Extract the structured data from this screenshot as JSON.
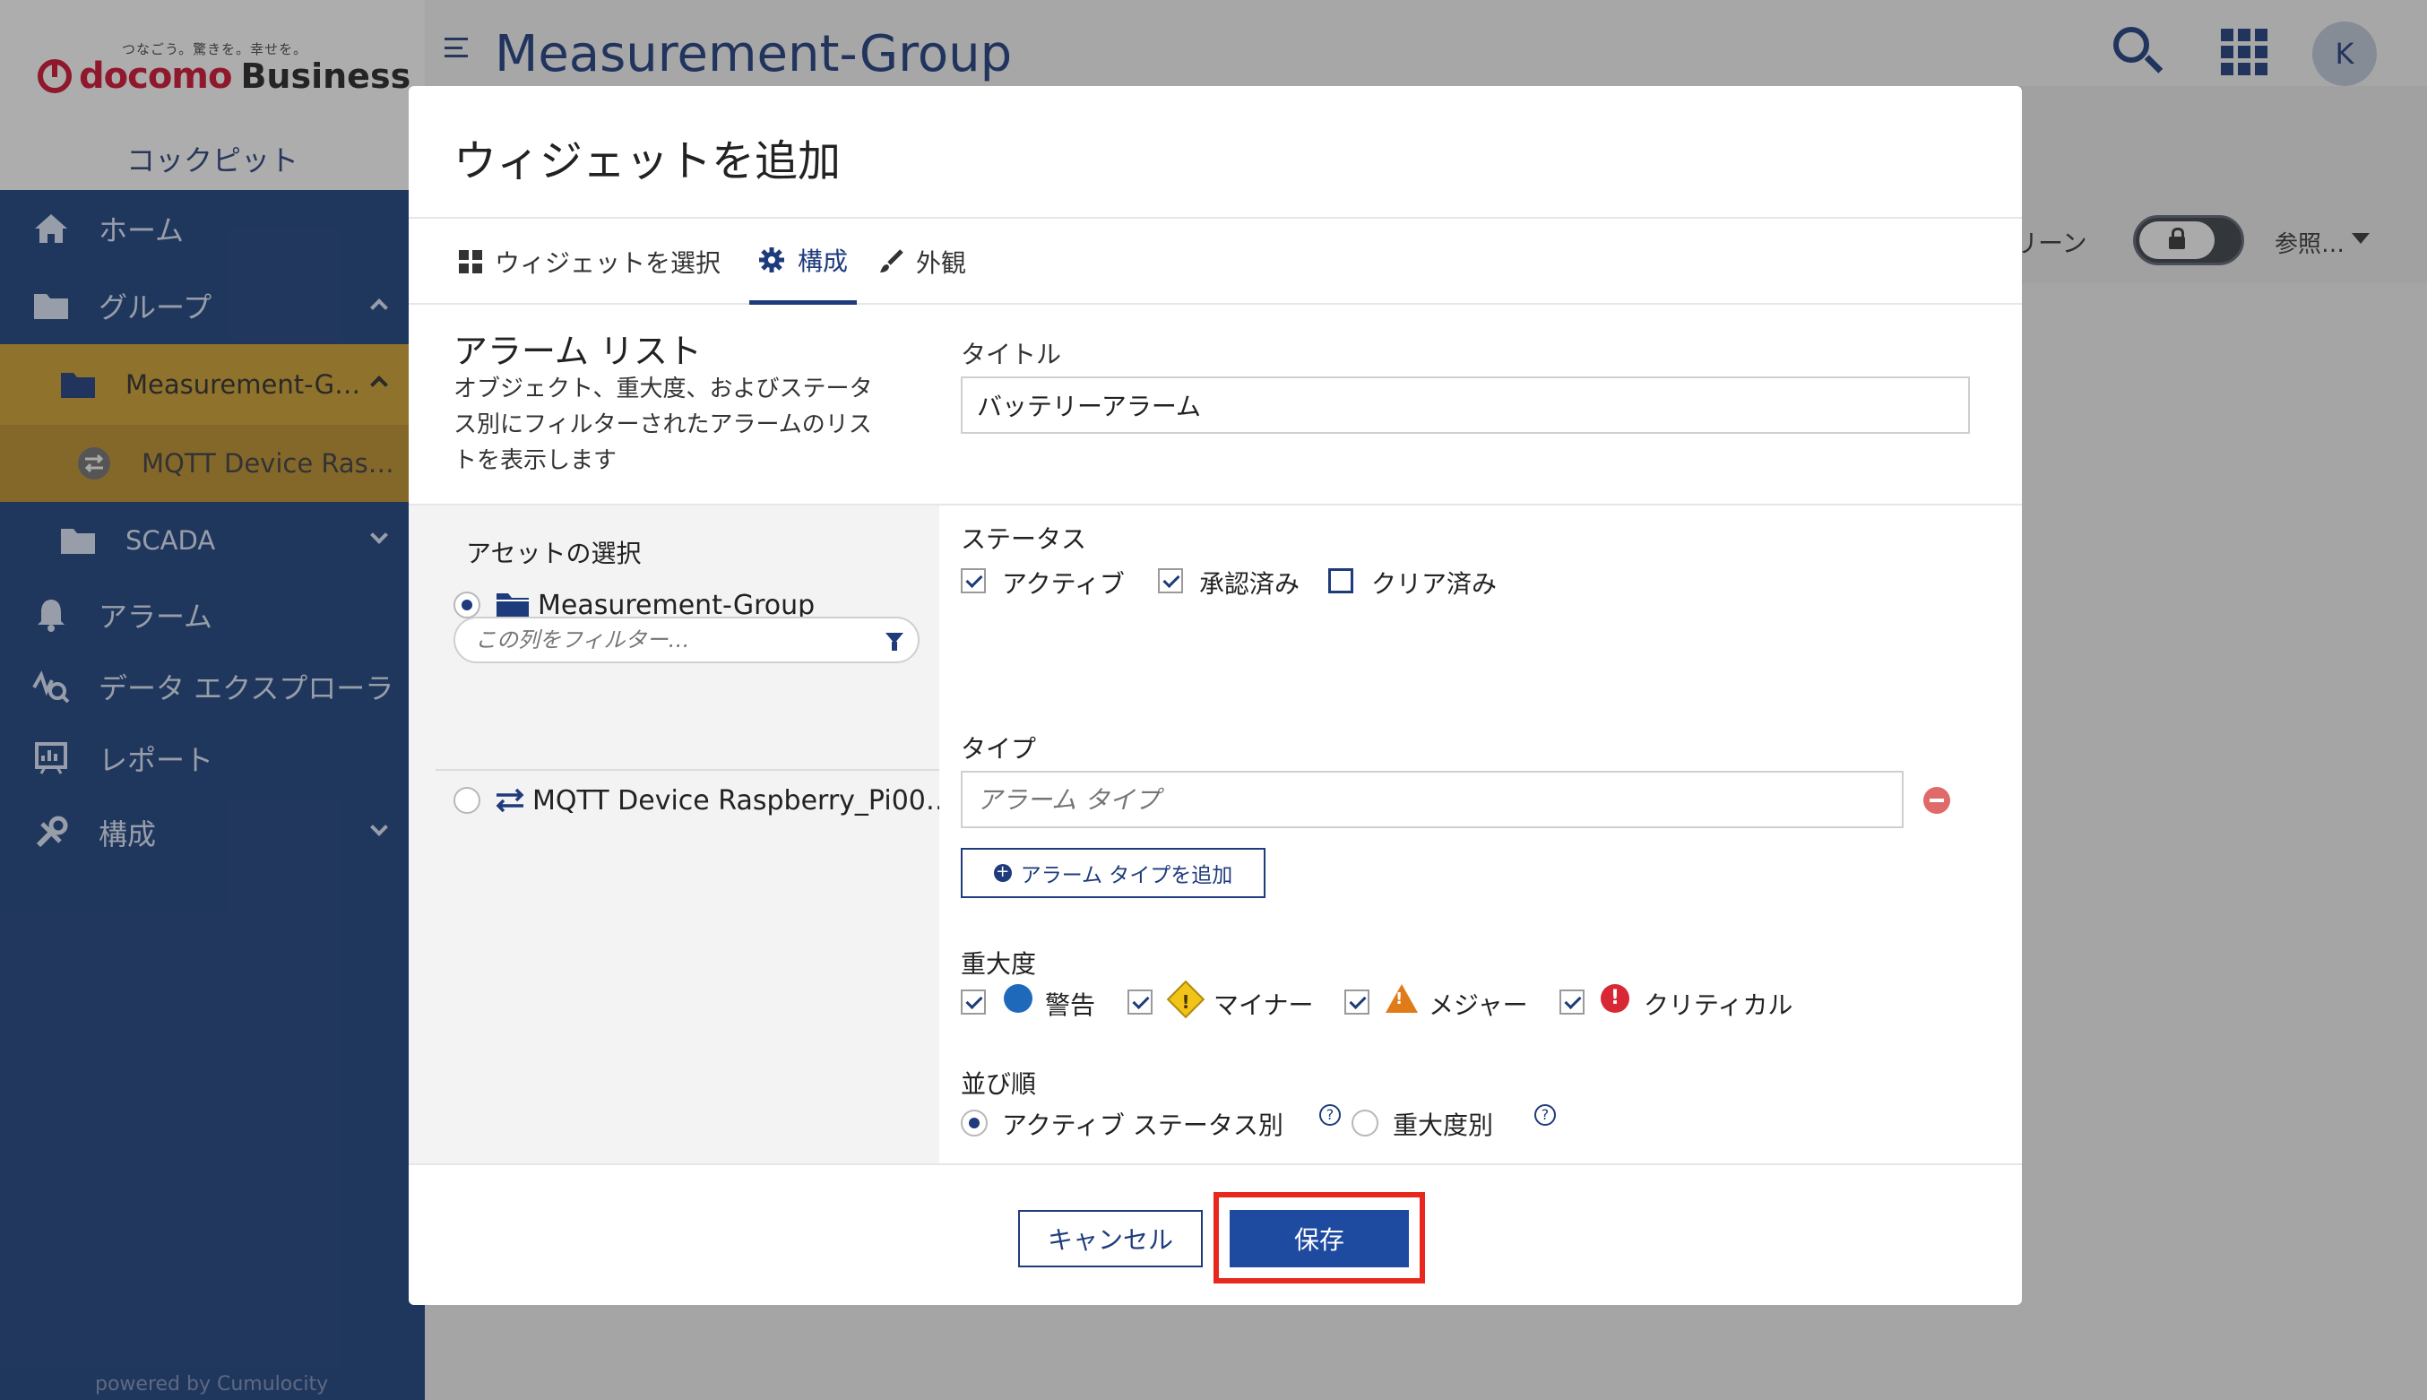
{
  "app": {
    "brand_tagline": "つなごう。驚きを。幸せを。",
    "brand_docomo": "docomo",
    "brand_business": "Business",
    "cockpit_label": "コックピット",
    "powered_by": "powered by Cumulocity",
    "page_title": "Measurement-Group",
    "avatar_initial": "K",
    "screen_label": "リーン",
    "reference_label": "参照…"
  },
  "sidebar": {
    "items": [
      {
        "label": "ホーム",
        "icon": "home-icon"
      },
      {
        "label": "グループ",
        "icon": "folder-icon"
      },
      {
        "label": "Measurement-G…",
        "icon": "folder-open-icon"
      },
      {
        "label": "MQTT Device Ras…",
        "icon": "device-icon"
      },
      {
        "label": "SCADA",
        "icon": "folder-icon"
      },
      {
        "label": "アラーム",
        "icon": "bell-icon"
      },
      {
        "label": "データ エクスプローラ",
        "icon": "data-explorer-icon"
      },
      {
        "label": "レポート",
        "icon": "report-icon"
      },
      {
        "label": "構成",
        "icon": "configuration-icon"
      }
    ]
  },
  "modal": {
    "title": "ウィジェットを追加",
    "tabs": [
      {
        "label": "ウィジェットを選択",
        "icon": "grid-icon"
      },
      {
        "label": "構成",
        "icon": "gear-icon"
      },
      {
        "label": "外観",
        "icon": "brush-icon"
      }
    ],
    "widget_name": "アラーム リスト",
    "widget_desc_lines": [
      "オブジェクト、重大度、およびステータ",
      "ス別にフィルターされたアラームのリス",
      "トを表示します"
    ],
    "title_label": "タイトル",
    "title_value": "バッテリーアラーム",
    "assets": {
      "label": "アセットの選択",
      "root": "Measurement-Group",
      "filter_placeholder": "この列をフィルター…",
      "child": "MQTT Device Raspberry_Pi00…"
    },
    "status": {
      "label": "ステータス",
      "options": [
        {
          "label": "アクティブ",
          "checked": true
        },
        {
          "label": "承認済み",
          "checked": true
        },
        {
          "label": "クリア済み",
          "checked": false
        }
      ]
    },
    "type": {
      "label": "タイプ",
      "placeholder": "アラーム タイプ",
      "add_button": "アラーム タイプを追加"
    },
    "severity": {
      "label": "重大度",
      "options": [
        {
          "label": "警告",
          "checked": true,
          "color": "#1f69bb"
        },
        {
          "label": "マイナー",
          "checked": true,
          "color": "#f0c419"
        },
        {
          "label": "メジャー",
          "checked": true,
          "color": "#e07b1a"
        },
        {
          "label": "クリティカル",
          "checked": true,
          "color": "#d82836"
        }
      ]
    },
    "order": {
      "label": "並び順",
      "options": [
        {
          "label": "アクティブ ステータス別",
          "selected": true
        },
        {
          "label": "重大度別",
          "selected": false
        }
      ]
    },
    "footer": {
      "cancel": "キャンセル",
      "save": "保存"
    }
  },
  "colors": {
    "primary": "#1e3b7c",
    "sidebar_bg": "#1d3f7a",
    "active_nav": "#c69a2d",
    "highlight": "#e8271d"
  }
}
